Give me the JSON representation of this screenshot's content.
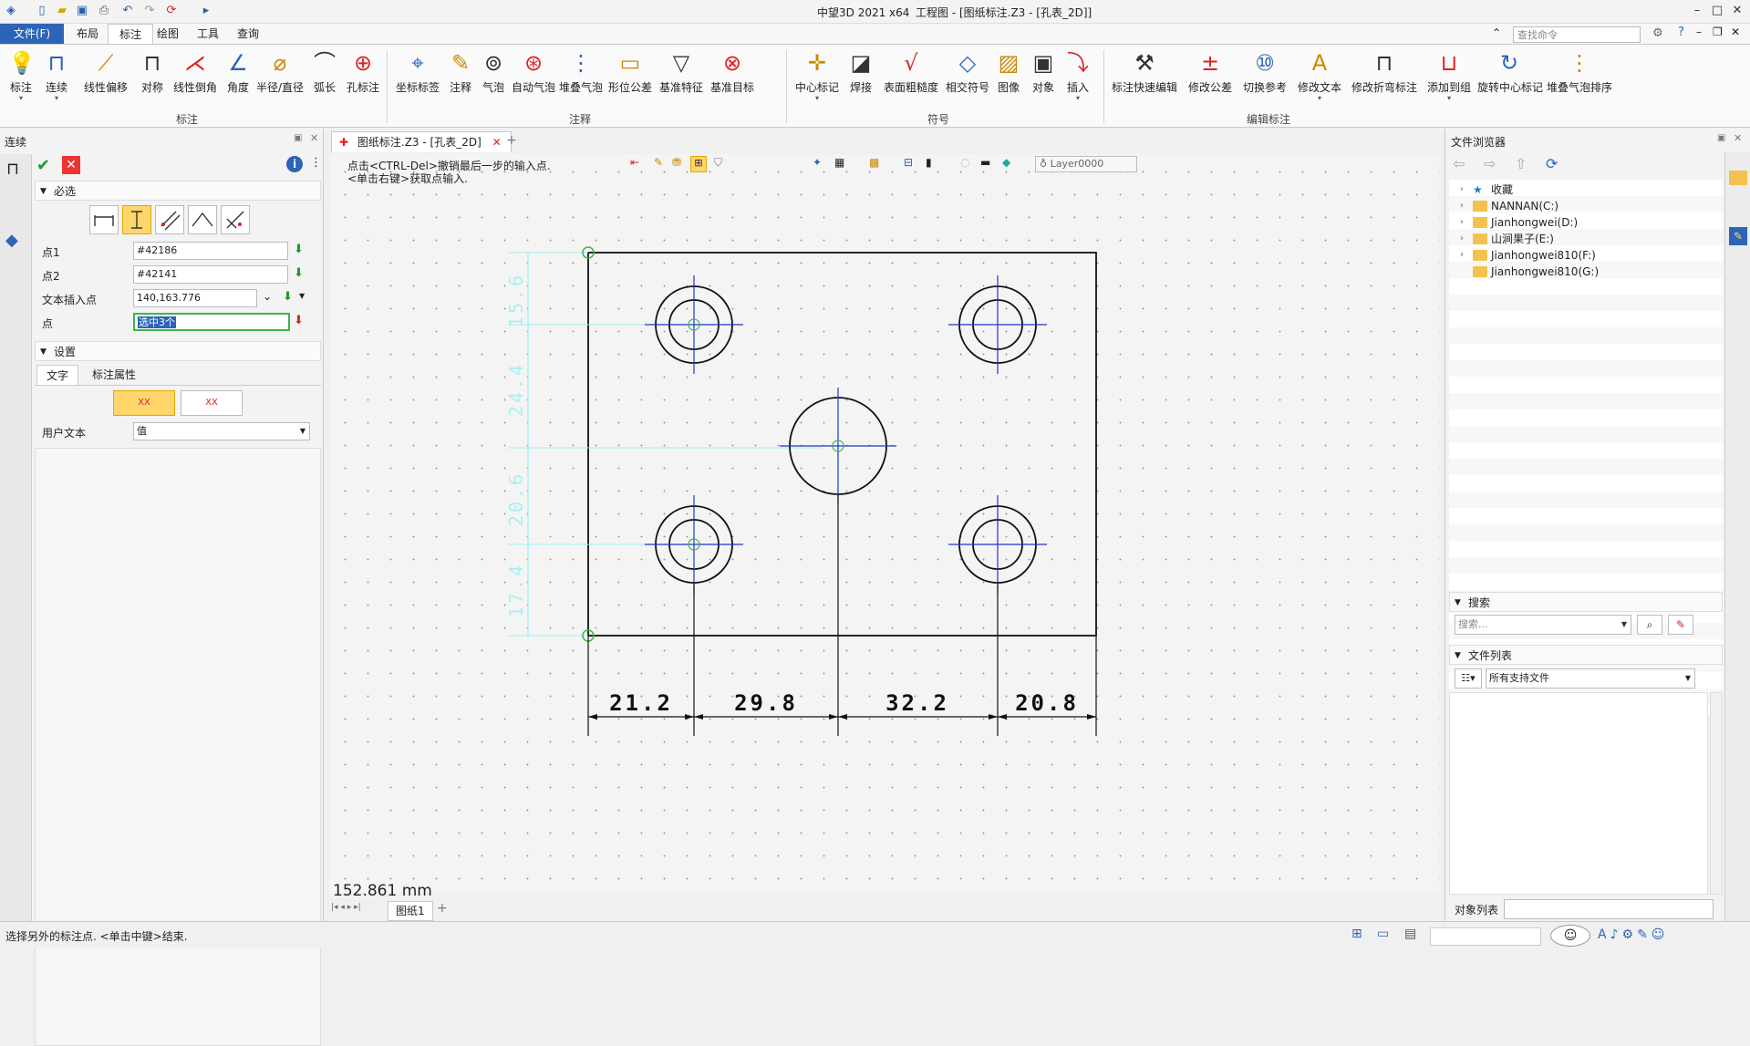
{
  "title": {
    "app": "中望3D 2021 x64",
    "doc": "工程图 - [图纸标注.Z3 - [孔表_2D]]"
  },
  "menu": {
    "file": "文件(F)",
    "items": [
      "布局",
      "标注",
      "绘图",
      "工具",
      "查询"
    ],
    "active": "标注",
    "search_placeholder": "查找命令"
  },
  "ribbon": {
    "groups": [
      {
        "label": "标注",
        "buttons": [
          "标注",
          "连续",
          "线性偏移",
          "对称",
          "线性倒角",
          "角度",
          "半径/直径",
          "弧长",
          "孔标注"
        ]
      },
      {
        "label": "注释",
        "buttons": [
          "坐标标签",
          "注释",
          "气泡",
          "自动气泡",
          "堆叠气泡",
          "形位公差",
          "基准特征",
          "基准目标"
        ]
      },
      {
        "label": "符号",
        "buttons": [
          "中心标记",
          "焊接",
          "表面粗糙度",
          "相交符号",
          "图像",
          "对象",
          "插入"
        ]
      },
      {
        "label": "编辑标注",
        "buttons": [
          "标注快速编辑",
          "修改公差",
          "切换参考",
          "修改文本",
          "修改折弯标注",
          "添加到组",
          "旋转中心标记",
          "堆叠气泡排序"
        ]
      }
    ]
  },
  "left_panel": {
    "title": "连续",
    "section_required": "必选",
    "fields": [
      {
        "label": "点1",
        "value": "#42186"
      },
      {
        "label": "点2",
        "value": "#42141"
      },
      {
        "label": "文本插入点",
        "value": "140,163.776"
      },
      {
        "label": "点",
        "value": "选中3个"
      }
    ],
    "section_settings": "设置",
    "tabs": [
      "文字",
      "标注属性"
    ],
    "user_text_label": "用户文本",
    "user_text_value": "值",
    "text_align_glyph": "XX"
  },
  "canvas": {
    "doc_tab": "图纸标注.Z3 - [孔表_2D]",
    "hint1": "点击<CTRL-Del>撤销最后一步的输入点.",
    "hint2": "<单击右键>获取点输入.",
    "layer": "Layer0000",
    "coord_readout": "152.861 mm",
    "sheet_tab": "图纸1"
  },
  "drawing": {
    "dims_bottom": [
      "21.2",
      "29.8",
      "32.2",
      "20.8"
    ],
    "dims_left": [
      "15.6",
      "24.4",
      "20.6",
      "17.4"
    ]
  },
  "right_panel": {
    "title": "文件浏览器",
    "tree": [
      "收藏",
      "NANNAN(C:)",
      "Jianhongwei(D:)",
      "山涧果子(E:)",
      "Jianhongwei810(F:)",
      "Jianhongwei810(G:)"
    ],
    "search_section": "搜索",
    "search_placeholder": "搜索...",
    "file_list_section": "文件列表",
    "file_filter": "所有支持文件",
    "object_list": "对象列表"
  },
  "status": {
    "text": "选择另外的标注点. <单击中键>结束."
  },
  "colors": {
    "accent": "#2b64b8",
    "highlight": "#ffd66b",
    "dim_cyan": "#8ee8ee",
    "center_blue": "#2233cc"
  }
}
